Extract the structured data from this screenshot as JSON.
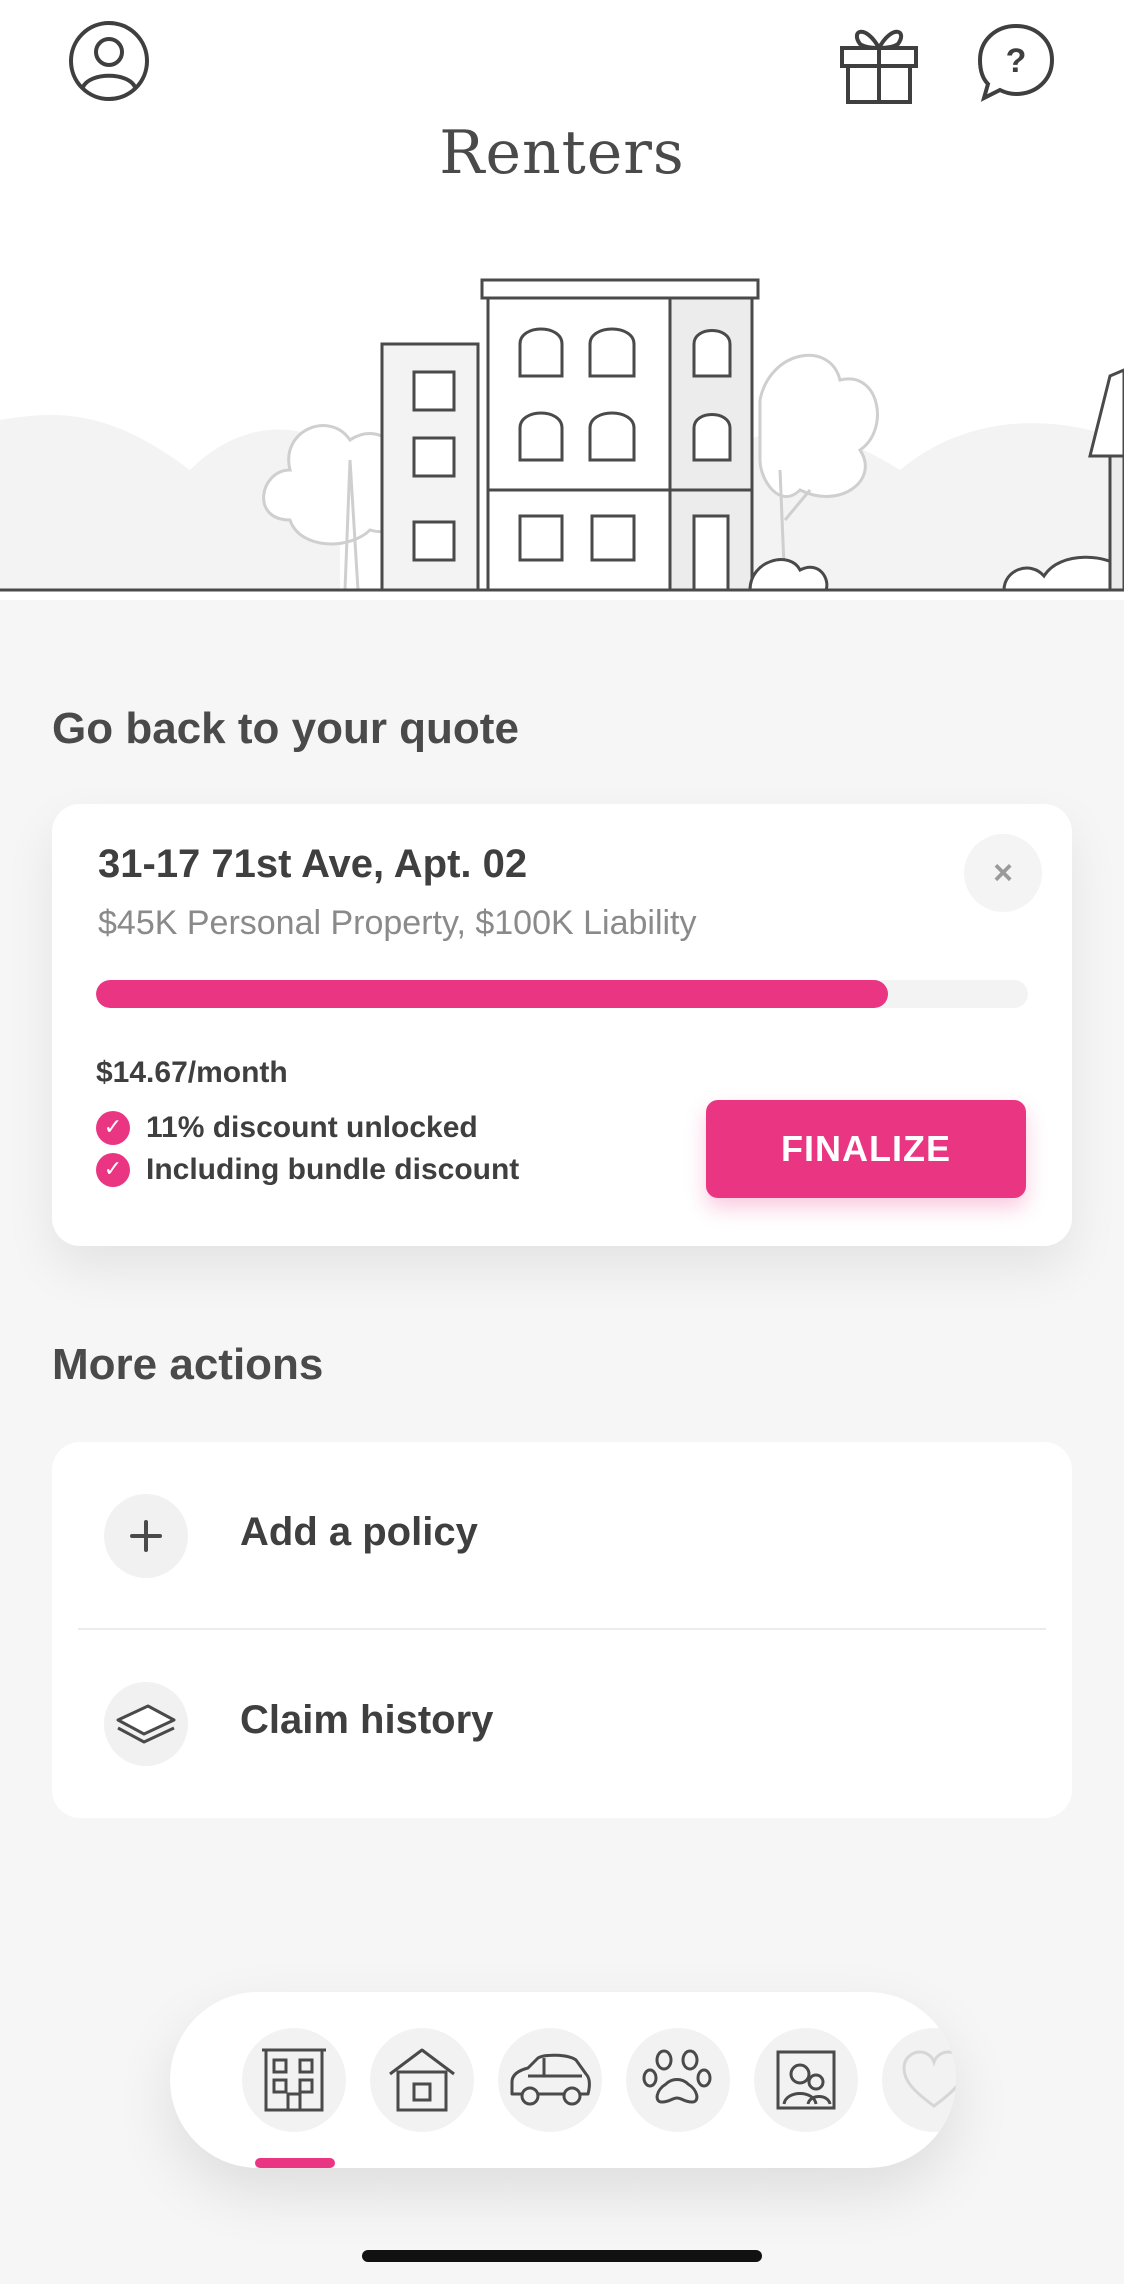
{
  "header": {
    "title": "Renters",
    "icons": [
      "profile-icon",
      "gift-icon",
      "help-icon"
    ]
  },
  "quote_section": {
    "title": "Go back to your quote",
    "address": "31-17 71st Ave, Apt. 02",
    "coverage": "$45K Personal Property, $100K Liability",
    "progress": 0.85,
    "price": "$14.67/month",
    "benefits": [
      "11% discount unlocked",
      "Including bundle discount"
    ],
    "finalize_label": "FINALIZE",
    "close_label": "×"
  },
  "more_actions": {
    "title": "More actions",
    "items": [
      {
        "label": "Add a policy",
        "icon": "plus-icon"
      },
      {
        "label": "Claim history",
        "icon": "layers-icon"
      }
    ]
  },
  "tabbar": {
    "tabs": [
      "renters-building-icon",
      "homeowners-house-icon",
      "car-icon",
      "pet-paw-icon",
      "life-portrait-icon",
      "heart-icon"
    ],
    "active": 0
  },
  "colors": {
    "accent": "#ea3583",
    "background": "#f6f6f6",
    "card": "#ffffff",
    "text": "#4a4a4a",
    "muted": "#8a8a8a"
  }
}
